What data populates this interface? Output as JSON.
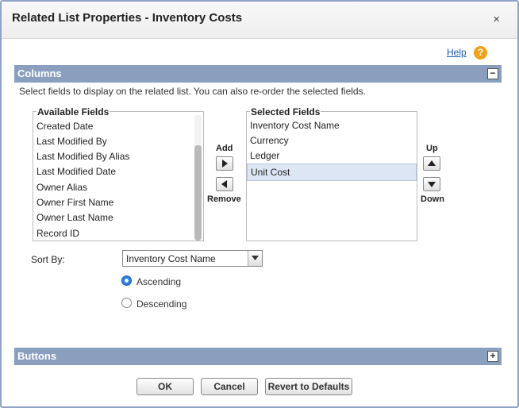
{
  "dialog": {
    "title": "Related List Properties - Inventory Costs",
    "close_glyph": "×",
    "help_label": "Help",
    "help_icon_glyph": "?"
  },
  "columns_section": {
    "title": "Columns",
    "toggle_glyph": "−",
    "description": "Select fields to display on the related list. You can also re-order the selected fields.",
    "available": {
      "header": "Available Fields",
      "items": [
        "Created Date",
        "Last Modified By",
        "Last Modified By Alias",
        "Last Modified Date",
        "Owner Alias",
        "Owner First Name",
        "Owner Last Name",
        "Record ID"
      ]
    },
    "selected": {
      "header": "Selected Fields",
      "items": [
        "Inventory Cost Name",
        "Currency",
        "Ledger",
        "Unit Cost"
      ],
      "highlighted": "Unit Cost"
    },
    "add_label": "Add",
    "remove_label": "Remove",
    "up_label": "Up",
    "down_label": "Down",
    "sort_by": {
      "label": "Sort By:",
      "value": "Inventory Cost Name",
      "ascending_label": "Ascending",
      "descending_label": "Descending",
      "order": "Ascending"
    }
  },
  "buttons_section": {
    "title": "Buttons",
    "toggle_glyph": "+"
  },
  "footer": {
    "ok_label": "OK",
    "cancel_label": "Cancel",
    "revert_label": "Revert to Defaults"
  },
  "colors": {
    "section_bar": "#8a9ebe",
    "frame": "#8ea3c6",
    "help_icon": "#f0a21b",
    "radio_checked": "#2a7de1",
    "selected_row": "#dde6f4"
  }
}
